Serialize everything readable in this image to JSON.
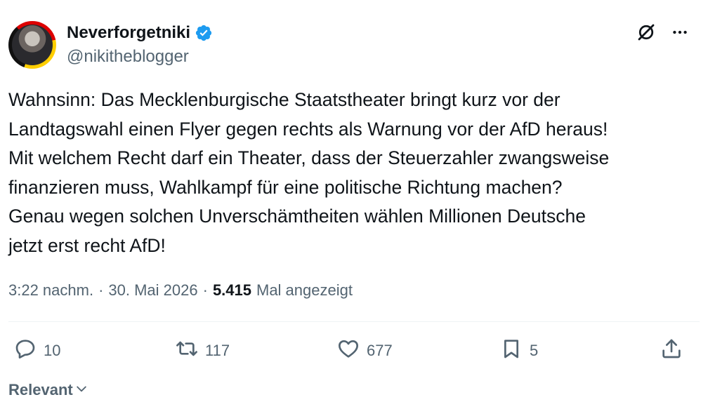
{
  "author": {
    "display_name": "Neverforgetniki",
    "handle": "@nikitheblogger",
    "verified_color": "#1d9bf0"
  },
  "tweet": {
    "text": "Wahnsinn: Das Mecklenburgische Staatstheater bringt kurz vor der\nLandtagswahl einen Flyer gegen rechts als Warnung vor der AfD heraus!\nMit welchem Recht darf ein Theater, dass der Steuerzahler zwangsweise\nfinanzieren muss, Wahlkampf für eine politische Richtung machen?\nGenau wegen solchen Unverschämtheiten wählen Millionen Deutsche\njetzt erst recht AfD!",
    "time": "3:22 nachm.",
    "date": "30. Mai 2026",
    "views": "5.415",
    "views_label": "Mal angezeigt",
    "separator": "·"
  },
  "actions": {
    "replies": "10",
    "retweets": "117",
    "likes": "677",
    "bookmarks": "5"
  },
  "sort": {
    "label": "Relevant"
  },
  "icons": {
    "header": [
      "grok-icon",
      "more-icon"
    ],
    "actions": [
      "reply-icon",
      "retweet-icon",
      "like-icon",
      "bookmark-icon",
      "share-icon"
    ],
    "sort": "chevron-down-icon"
  },
  "colors": {
    "text": "#0f1419",
    "secondary": "#536471",
    "accent": "#1d9bf0"
  }
}
